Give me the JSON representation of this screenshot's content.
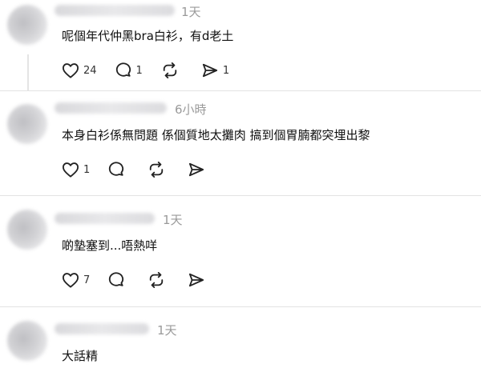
{
  "comments": [
    {
      "time": "1天",
      "text": "呢個年代仲黑bra白衫，有d老土",
      "likes": "24",
      "replies": "1",
      "reposts": "",
      "shares": "1"
    },
    {
      "time": "6小時",
      "text": "本身白衫係無問題 係個質地太攤肉 搞到個胃腩都突埋出黎",
      "likes": "1",
      "replies": "",
      "reposts": "",
      "shares": ""
    },
    {
      "time": "1天",
      "text": "啲墊塞到...唔熱咩",
      "likes": "7",
      "replies": "",
      "reposts": "",
      "shares": ""
    },
    {
      "time": "1天",
      "text": "大話精",
      "likes": "",
      "replies": "",
      "reposts": "",
      "shares": ""
    }
  ],
  "icons": {
    "like": "heart-icon",
    "reply": "comment-bubble-icon",
    "repost": "repost-icon",
    "share": "send-icon"
  }
}
